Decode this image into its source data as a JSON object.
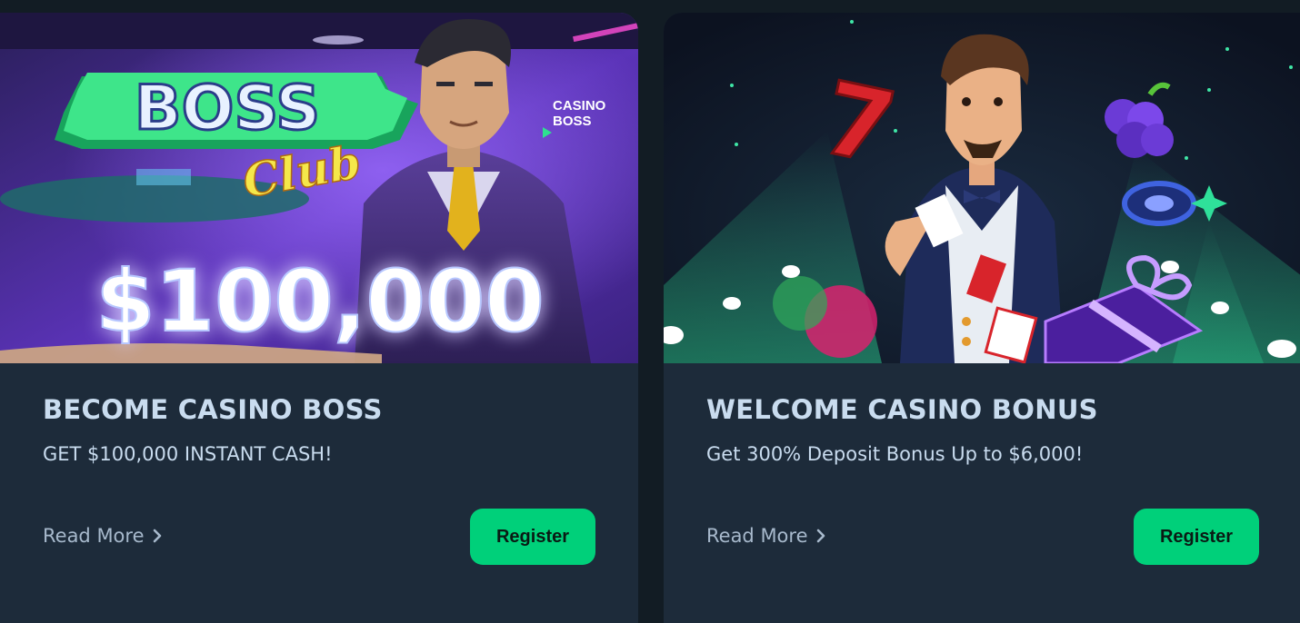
{
  "cards": [
    {
      "title": "BECOME CASINO BOSS",
      "subtitle": "GET $100,000 INSTANT CASH!",
      "read_more": "Read More",
      "register": "Register",
      "banner": {
        "logo_text": "BOSS",
        "logo_script": "Club",
        "badge_line1": "CASINO",
        "badge_line2": "BOSS",
        "amount": "$100,000"
      }
    },
    {
      "title": "WELCOME CASINO BONUS",
      "subtitle": "Get 300% Deposit Bonus Up to $6,000!",
      "read_more": "Read More",
      "register": "Register",
      "banner": {
        "seven": "7"
      }
    }
  ],
  "colors": {
    "page_bg": "#121c24",
    "card_bg": "#1d2b3a",
    "title": "#c9dcef",
    "accent_green": "#00d07a"
  }
}
